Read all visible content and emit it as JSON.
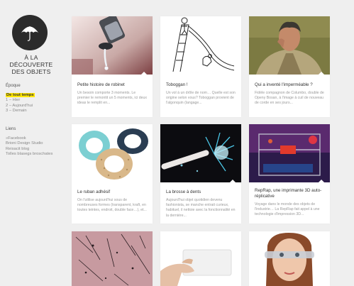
{
  "site": {
    "logo_line1": "À LA DÉCOUVERTE",
    "logo_line2": "DES OBJETS",
    "logo_icon": "umbrella-icon"
  },
  "sidebar": {
    "epoque_heading": "Époque",
    "epoques": [
      {
        "label": "De tout temps",
        "active": true
      },
      {
        "label": "1 – Hier",
        "active": false
      },
      {
        "label": "2 – Aujourd'hui",
        "active": false
      },
      {
        "label": "3 – Demain",
        "active": false
      }
    ],
    "liens_heading": "Liens",
    "liens": [
      {
        "label": "»Facebook"
      },
      {
        "label": "Brioni Design Studio"
      },
      {
        "label": "Reisacit blog"
      },
      {
        "label": "Tolles blasegs broschates"
      }
    ],
    "accent_color": "#ffe600"
  },
  "cards": [
    {
      "title": "Petite histoire de robinet",
      "excerpt": "Un besoin comporte 3 moments. Le premier le remontit un 5 moments, ici deux ideas le remplit en..."
    },
    {
      "title": "Toboggan !",
      "excerpt": "Un vol à un drôle de nom… Quelle est son origine selon vous? Toboggan provient de l'algonquin (langage..."
    },
    {
      "title": "Qui a inventé l'imperméable ?",
      "excerpt": "Fidèle compagnon de Columbo, double de Openy Bosan, à l'image à cuil de nouveau de corde en ses jours..."
    },
    {
      "title": "Le ruban adhésif",
      "excerpt": "On l'utilise aujourd'hui sous de nombreuses formes (transparent, kraft, en toutes teintes, endroit, double face…), et..."
    },
    {
      "title": "La brosse à dents",
      "excerpt": "Aujourd'hui objet quotidien devenu fashionista, se manche entrait curieux, habituel, il nettoie avec la fonctionnalité en la dernière..."
    },
    {
      "title": "RepRap, une imprimante 3D auto-réplicative",
      "excerpt": "Voyage dans le monde des objets de l'industrie… La RepRap fait appel à une technologie d'impression 3D..."
    },
    {
      "title": "",
      "excerpt": ""
    },
    {
      "title": "",
      "excerpt": ""
    },
    {
      "title": "",
      "excerpt": ""
    }
  ]
}
